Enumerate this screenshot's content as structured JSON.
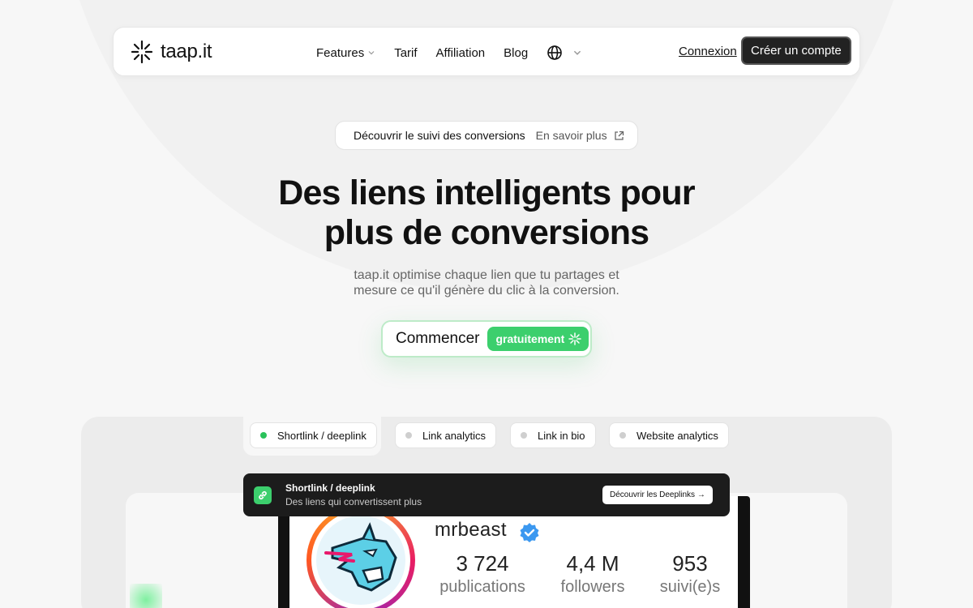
{
  "brand": {
    "name": "taap.it",
    "accent": "#3ccf6d"
  },
  "nav": {
    "items": [
      {
        "label": "Features",
        "has_dropdown": true
      },
      {
        "label": "Tarif"
      },
      {
        "label": "Affiliation"
      },
      {
        "label": "Blog"
      }
    ],
    "language_icon": "globe-icon",
    "login": "Connexion",
    "signup": "Créer un compte"
  },
  "announcement": {
    "text": "Découvrir le suivi des conversions",
    "link": "En savoir plus"
  },
  "hero": {
    "title_line1": "Des liens intelligents pour",
    "title_line2": "plus de conversions",
    "subtitle_line1": "taap.it optimise chaque lien que tu partages et",
    "subtitle_line2": "mesure ce qu'il génère du clic à la conversion.",
    "cta_label": "Commencer",
    "cta_badge": "gratuitement"
  },
  "tabs": [
    {
      "label": "Shortlink / deeplink",
      "active": true
    },
    {
      "label": "Link analytics",
      "active": false
    },
    {
      "label": "Link in bio",
      "active": false
    },
    {
      "label": "Website analytics",
      "active": false
    }
  ],
  "banner": {
    "title": "Shortlink / deeplink",
    "subtitle": "Des liens qui convertissent plus",
    "button": "Découvrir les Deeplinks →"
  },
  "profile": {
    "username": "mrbeast",
    "stats": [
      {
        "value": "3 724",
        "label": "publications"
      },
      {
        "value": "4,4 M",
        "label": "followers"
      },
      {
        "value": "953",
        "label": "suivi(e)s"
      }
    ]
  }
}
